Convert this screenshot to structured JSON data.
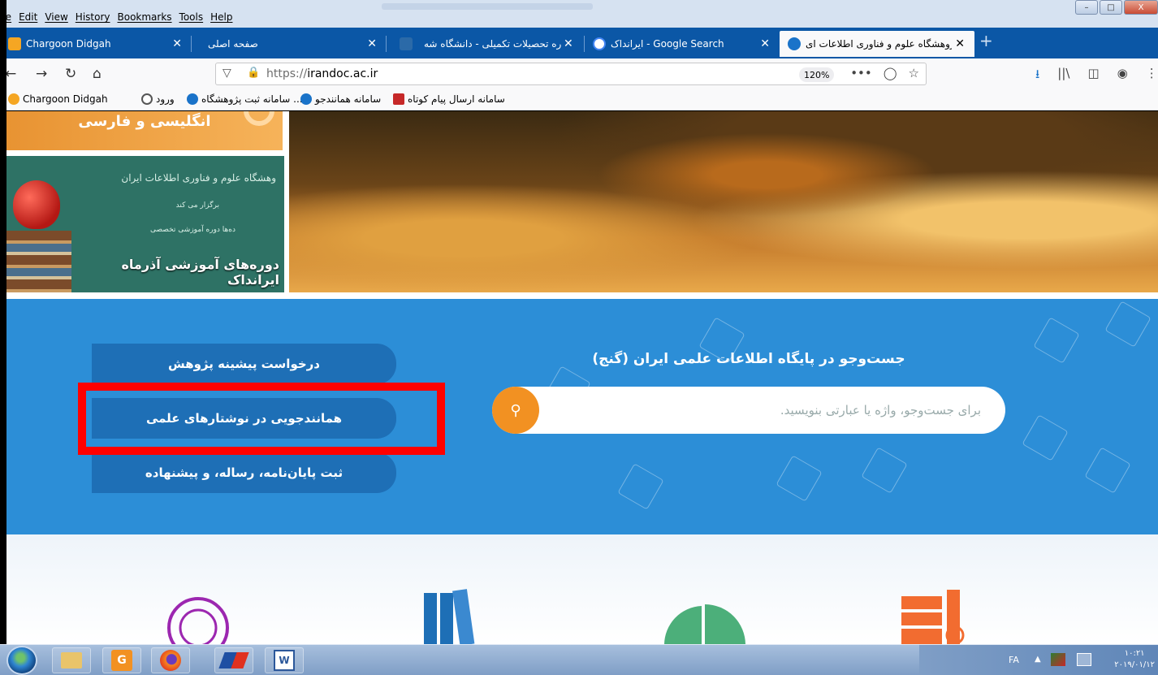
{
  "menu": [
    "ile",
    "Edit",
    "View",
    "History",
    "Bookmarks",
    "Tools",
    "Help"
  ],
  "tabs": [
    {
      "label": "Chargoon Didgah",
      "icon": "chargoon-icon",
      "color": "#f5a623"
    },
    {
      "label": "صفحه اصلی",
      "icon": "none"
    },
    {
      "label": "اداره تحصیلات تکمیلی - دانشگاه شه",
      "icon": "university-icon",
      "color": "#2b6aa8"
    },
    {
      "label": "ایرانداک - Google Search",
      "icon": "google-icon",
      "color": "#4285f4"
    },
    {
      "label": "پژوهشگاه علوم و فناوری اطلاعات ای",
      "icon": "irandoc-icon",
      "color": "#1a73c9"
    }
  ],
  "nav": {
    "url_scheme": "https://",
    "url_host": "irandoc.ac.ir",
    "zoom": "120%",
    "more": "•••"
  },
  "bookmarks": [
    {
      "label": "Chargoon Didgah",
      "color": "#f5a623"
    },
    {
      "label": "ورود",
      "color": "#555"
    },
    {
      "label": "سامانه ثبت پژوهشگاه ...",
      "color": "#1a73c9"
    },
    {
      "label": "سامانه همانندجو",
      "color": "#1a73c9"
    },
    {
      "label": "سامانه ارسال پیام کوتاه",
      "color": "#c62828"
    }
  ],
  "side": {
    "box1_text": "انگلیسی و فارسی",
    "board_line1": "وهشگاه علوم و فناوری اطلاعات ایران",
    "board_line2": "برگزار می کند",
    "board_line3": "ده‌ها دوره آموزشی تخصصی",
    "caption": "دوره‌های آموزشی آذرماه ایرانداک"
  },
  "services": {
    "btn1": "درخواست پیشینه پژوهش",
    "btn2": "همانندجویی در نوشتارهای علمی",
    "btn3": "ثبت پایان‌نامه، رساله، و پیشنهاده"
  },
  "search": {
    "title": "جست‌وجو در پایگاه اطلاعات علمی ایران (گنج)",
    "placeholder": "برای جست‌وجو، واژه یا عبارتی بنویسید."
  },
  "taskbar": {
    "lang": "FA",
    "time": "۱۰:۲۱",
    "date": "۲۰۱۹/۰۱/۱۲"
  },
  "colors": {
    "accent_blue": "#2c8ed7",
    "button_blue": "#1e6fb6",
    "search_orange": "#f29122",
    "highlight_red": "#ff0000"
  }
}
